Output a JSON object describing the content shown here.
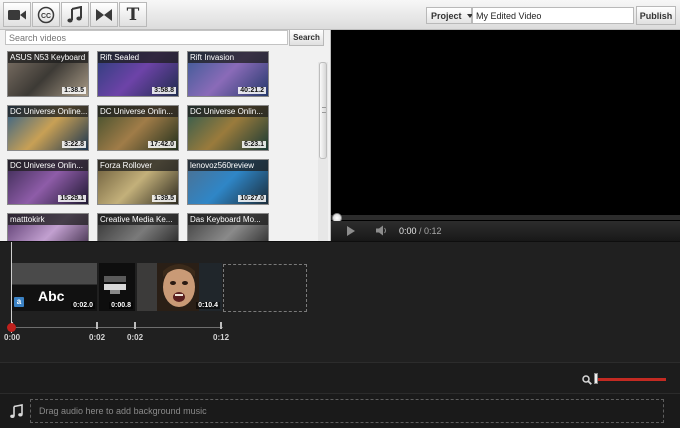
{
  "toolbar": {
    "tools": [
      {
        "name": "video-camera-icon"
      },
      {
        "name": "captions-cc-icon"
      },
      {
        "name": "music-note-icon"
      },
      {
        "name": "transition-bowtie-icon"
      },
      {
        "name": "text-icon",
        "glyph": "T"
      }
    ],
    "project_label": "Project",
    "project_name": "My Edited Video",
    "publish_label": "Publish"
  },
  "browser": {
    "search_placeholder": "Search videos",
    "search_label": "Search",
    "videos": [
      {
        "title": "ASUS N53 Keyboard",
        "duration": "1:38.5",
        "colors": [
          "#7e7266",
          "#3d3a35",
          "#a89a86"
        ]
      },
      {
        "title": "Rift Sealed",
        "duration": "3:58.8",
        "colors": [
          "#2b3f7a",
          "#6d43a8",
          "#1f2c4d"
        ]
      },
      {
        "title": "Rift Invasion",
        "duration": "40:21.2",
        "colors": [
          "#3a5a95",
          "#8a6bb8",
          "#24386b"
        ]
      },
      {
        "title": "DC Universe Online...",
        "duration": "3:22.8",
        "colors": [
          "#2e5f8a",
          "#c8a055",
          "#1b3550"
        ]
      },
      {
        "title": "DC Universe Onlin...",
        "duration": "17:42.0",
        "colors": [
          "#3f4d2c",
          "#a07c48",
          "#22301d"
        ]
      },
      {
        "title": "DC Universe Onlin...",
        "duration": "6:23.1",
        "colors": [
          "#2d5a4f",
          "#9a7b3c",
          "#1a3a35"
        ]
      },
      {
        "title": "DC Universe Onlin...",
        "duration": "15:29.1",
        "colors": [
          "#3a2a52",
          "#8e5ca8",
          "#1e1730"
        ]
      },
      {
        "title": "Forza Rollover",
        "duration": "1:39.5",
        "colors": [
          "#6a5b3a",
          "#c3b07a",
          "#2d2a1f"
        ]
      },
      {
        "title": "lenovoz560review",
        "duration": "10:27.0",
        "colors": [
          "#4d6f8f",
          "#2f86c7",
          "#1b2c3a"
        ]
      },
      {
        "title": "matttokirk",
        "duration": "",
        "colors": [
          "#5a3a6f",
          "#c2a0d0",
          "#2a1c33"
        ]
      },
      {
        "title": "Creative Media Ke...",
        "duration": "",
        "colors": [
          "#333333",
          "#7a7a7a",
          "#151515"
        ]
      },
      {
        "title": "Das Keyboard Mo...",
        "duration": "",
        "colors": [
          "#3f3f3f",
          "#8a8a8a",
          "#1a1a1a"
        ]
      }
    ]
  },
  "player": {
    "current_time": "0:00",
    "separator": " / ",
    "total_time": "0:12"
  },
  "timeline": {
    "clips": [
      {
        "label": "Abc",
        "type": "text",
        "duration": "0:02.0",
        "badge": "a"
      },
      {
        "type": "transition",
        "duration": "0:00.8"
      },
      {
        "type": "video",
        "duration": "0:10.4"
      }
    ],
    "ruler": [
      "0:00",
      "0:02",
      "0:02",
      "0:12"
    ],
    "audio_hint": "Drag audio here to add background music",
    "zoom_level": 0.03
  },
  "colors": {
    "accent_red": "#c32a22",
    "timeline_bg": "#1c1c1c",
    "player_bg": "#000000"
  }
}
